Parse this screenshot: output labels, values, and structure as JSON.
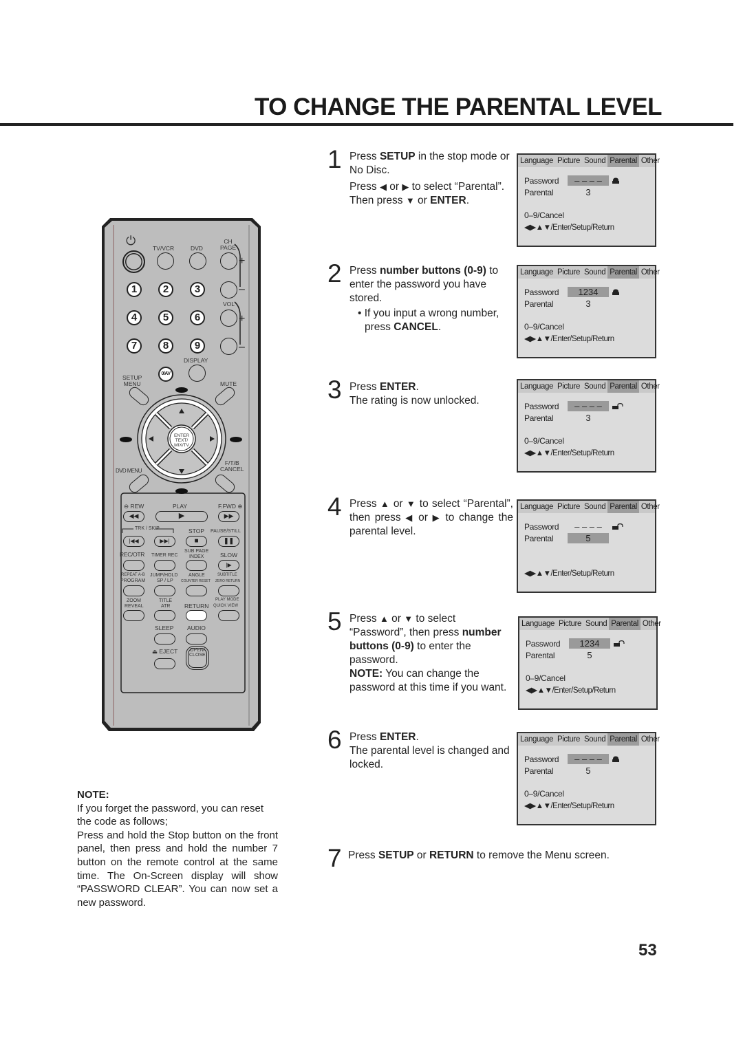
{
  "page": {
    "title": "TO CHANGE THE PARENTAL LEVEL",
    "page_number": "53"
  },
  "steps": [
    {
      "number": "1",
      "lines": [
        {
          "pre": "Press ",
          "bold": "SETUP",
          "post": " in the stop mode or No Disc."
        },
        {
          "pre": "Press ",
          "icon1": "◀",
          "mid": " or ",
          "icon2": "▶",
          "post": " to select “Parental”. Then press ",
          "icon3": "▼",
          "post2": " or ",
          "bold2": "ENTER",
          "post3": "."
        }
      ],
      "osd": {
        "tabs": [
          "Language",
          "Picture",
          "Sound",
          "Parental",
          "Other"
        ],
        "active_tab": "Parental",
        "password_label": "Password",
        "password_value": "– – – –",
        "parental_label": "Parental",
        "parental_value": "3",
        "highlight": "password",
        "lock_state": "locked",
        "footer1": "0–9/Cancel",
        "footer2": "◀▶▲▼/Enter/Setup/Return"
      }
    },
    {
      "number": "2",
      "lines": [
        {
          "pre": "Press ",
          "bold": "number buttons  (0-9)",
          "post": " to enter the password you have stored."
        },
        {
          "bullet": "• If you input a wrong number, press ",
          "bold": "CANCEL",
          "post": "."
        }
      ],
      "osd": {
        "tabs": [
          "Language",
          "Picture",
          "Sound",
          "Parental",
          "Other"
        ],
        "active_tab": "Parental",
        "password_label": "Password",
        "password_value": "1234",
        "parental_label": "Parental",
        "parental_value": "3",
        "highlight": "password",
        "lock_state": "locked",
        "footer1": "0–9/Cancel",
        "footer2": "◀▶▲▼/Enter/Setup/Return"
      }
    },
    {
      "number": "3",
      "lines": [
        {
          "pre": "Press ",
          "bold": "ENTER",
          "post": "."
        },
        {
          "pre": "The rating is now unlocked."
        }
      ],
      "osd": {
        "tabs": [
          "Language",
          "Picture",
          "Sound",
          "Parental",
          "Other"
        ],
        "active_tab": "Parental",
        "password_label": "Password",
        "password_value": "– – – –",
        "parental_label": "Parental",
        "parental_value": "3",
        "highlight": "password",
        "lock_state": "unlocked",
        "footer1": "0–9/Cancel",
        "footer2": "◀▶▲▼/Enter/Setup/Return"
      }
    },
    {
      "number": "4",
      "lines": [
        {
          "pre": "Press ",
          "icon1": "▲",
          "mid": " or ",
          "icon2": "▼",
          "post": " to select “Parental”, then press ",
          "icon3": "◀",
          "post2": " or ",
          "icon4": "▶",
          "post3": " to change the parental level."
        }
      ],
      "osd": {
        "tabs": [
          "Language",
          "Picture",
          "Sound",
          "Parental",
          "Other"
        ],
        "active_tab": "Parental",
        "password_label": "Password",
        "password_value": "– – – –",
        "parental_label": "Parental",
        "parental_value": "5",
        "highlight": "parental",
        "lock_state": "unlocked",
        "footer1": "",
        "footer2": "◀▶▲▼/Enter/Setup/Return"
      }
    },
    {
      "number": "5",
      "lines": [
        {
          "pre": "Press ",
          "icon1": "▲",
          "mid": " or ",
          "icon2": "▼",
          "post": " to select “Password”, then press ",
          "bold": "number buttons (0-9)",
          "post2": " to enter the password."
        },
        {
          "bold": "NOTE:",
          "post": " You can change the password at this time if you want."
        }
      ],
      "osd": {
        "tabs": [
          "Language",
          "Picture",
          "Sound",
          "Parental",
          "Other"
        ],
        "active_tab": "Parental",
        "password_label": "Password",
        "password_value": "1234",
        "parental_label": "Parental",
        "parental_value": "5",
        "highlight": "password",
        "lock_state": "unlocked",
        "footer1": "0–9/Cancel",
        "footer2": "◀▶▲▼/Enter/Setup/Return"
      }
    },
    {
      "number": "6",
      "lines": [
        {
          "pre": "Press ",
          "bold": "ENTER",
          "post": "."
        },
        {
          "pre": "The parental level is changed and locked."
        }
      ],
      "osd": {
        "tabs": [
          "Language",
          "Picture",
          "Sound",
          "Parental",
          "Other"
        ],
        "active_tab": "Parental",
        "password_label": "Password",
        "password_value": "– – – –",
        "parental_label": "Parental",
        "parental_value": "5",
        "highlight": "password",
        "lock_state": "locked",
        "footer1": "0–9/Cancel",
        "footer2": "◀▶▲▼/Enter/Setup/Return"
      }
    },
    {
      "number": "7",
      "lines": [
        {
          "pre": "Press ",
          "bold": "SETUP",
          "mid": " or ",
          "bold2": "RETURN",
          "post": " to remove the Menu screen."
        }
      ]
    }
  ],
  "note": {
    "heading": "NOTE:",
    "para1": "If you forget the password, you can reset the code as follows;",
    "para2": "Press and hold the Stop button on the front panel, then press and hold the number 7 button on the remote control at the same time. The On-Screen display will show “PASSWORD CLEAR”. You can now set a new password."
  },
  "remote": {
    "labels": {
      "power": "⏻",
      "tv_vcr": "TV/VCR",
      "dvd": "DVD",
      "ch_page": "CH\nPAGE",
      "vol": "VOL",
      "numbers": [
        "1",
        "2",
        "3",
        "4",
        "5",
        "6",
        "7",
        "8",
        "9"
      ],
      "display": "DISPLAY",
      "zero_av": "0/AV",
      "setup_menu": "SETUP\nMENU",
      "mute": "MUTE",
      "enter": "ENTER\nTEXT/\nMIX/TV",
      "dvd_menu": "DVD MENU",
      "ftb_cancel": "F/T/B\nCANCEL",
      "rew": "⊖ REW",
      "play": "PLAY",
      "ffwd": "F.FWD ⊕",
      "trk_skip": "TRK / SKIP",
      "stop": "STOP",
      "pause_still": "PAUSE/STILL",
      "rec_otr": "REC/OTR",
      "timer_rec": "TIMER REC",
      "sub_page_index": "SUB PAGE\nINDEX",
      "slow": "SLOW",
      "repeat_ab": "REPEAT A-B",
      "program": "PROGRAM",
      "jump_hold": "JUMP/HOLD",
      "sp_lp": "SP / LP",
      "angle": "ANGLE",
      "counter_reset": "COUNTER RESET",
      "subtitle": "SUBTITLE",
      "zero_return": "ZERO RETURN",
      "zoom": "ZOOM",
      "reveal": "REVEAL",
      "title": "TITLE",
      "atr": "ATR",
      "return": "RETURN",
      "play_mode": "PLAY MODE",
      "quick_view": "QUICK VIEW",
      "sleep": "SLEEP",
      "audio": "AUDIO",
      "eject": "⏏ EJECT",
      "open_close": "OPEN/\nCLOSE"
    }
  }
}
